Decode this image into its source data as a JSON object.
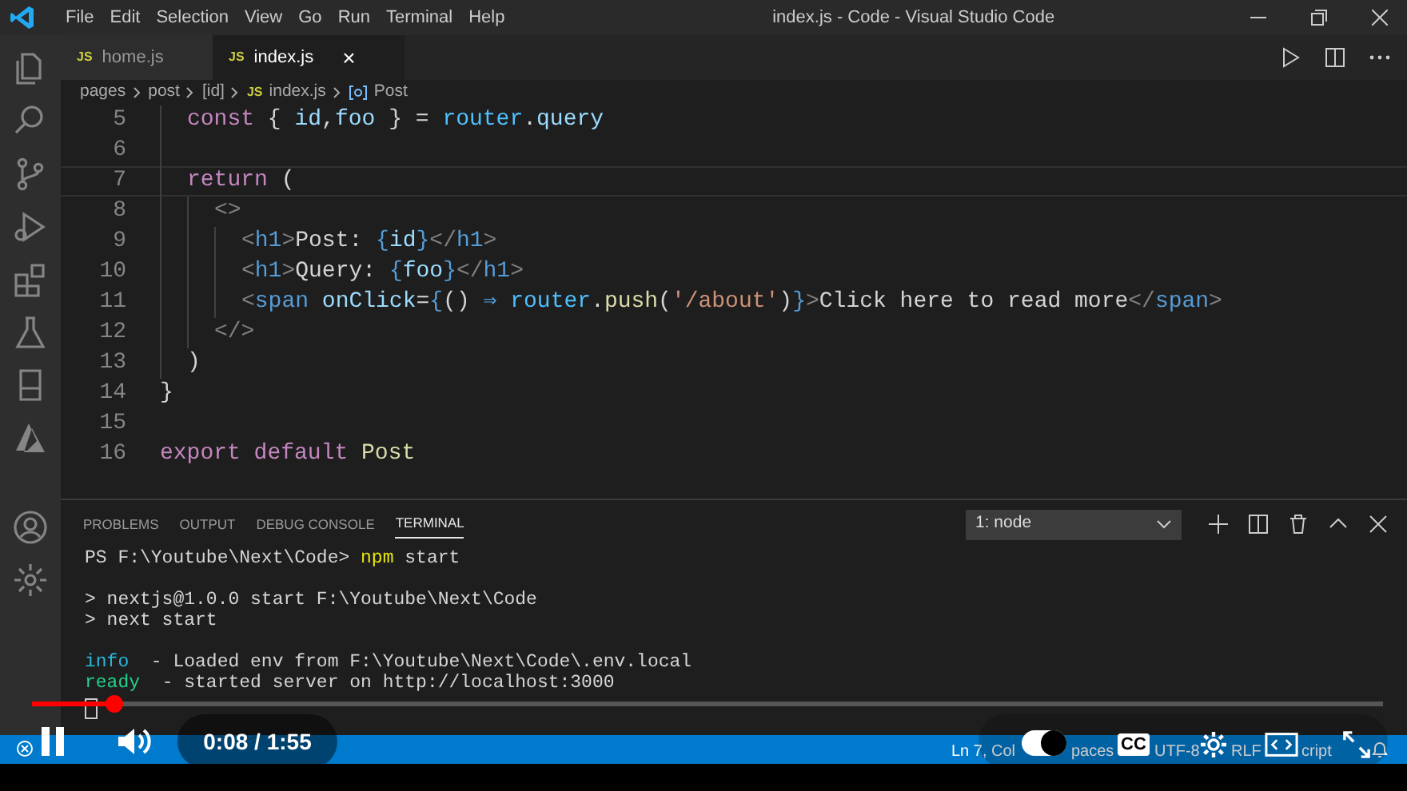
{
  "title_bar": {
    "menu": [
      "File",
      "Edit",
      "Selection",
      "View",
      "Go",
      "Run",
      "Terminal",
      "Help"
    ],
    "title": "index.js - Code - Visual Studio Code"
  },
  "tabs": [
    {
      "badge": "JS",
      "label": "home.js",
      "selected": false
    },
    {
      "badge": "JS",
      "label": "index.js",
      "selected": true,
      "close": "×"
    }
  ],
  "breadcrumbs": [
    {
      "kind": "folder",
      "label": "pages"
    },
    {
      "kind": "folder",
      "label": "post"
    },
    {
      "kind": "folder",
      "label": "[id]"
    },
    {
      "kind": "file",
      "badge": "JS",
      "label": "index.js"
    },
    {
      "kind": "symbol",
      "label": "Post"
    }
  ],
  "editor": {
    "lines": [
      {
        "children": [
          {
            "number": "5",
            "current": false,
            "tokens": [
              {
                "kind": "keyword",
                "text": "const "
              },
              {
                "kind": "text",
                "text": "{ "
              },
              {
                "kind": "var",
                "text": "id"
              },
              {
                "kind": "text",
                "text": ","
              },
              {
                "kind": "var",
                "text": "foo"
              },
              {
                "kind": "text",
                "text": " } = "
              },
              {
                "kind": "obj",
                "text": "router"
              },
              {
                "kind": "text",
                "text": "."
              },
              {
                "kind": "var",
                "text": "query"
              }
            ]
          },
          {
            "number": "6",
            "current": false
          },
          {
            "number": "7",
            "current": true,
            "tokens": [
              {
                "kind": "keyword",
                "text": "return "
              },
              {
                "kind": "text",
                "text": "("
              }
            ],
            "children": [
              {
                "number": "8",
                "current": false,
                "tokens": [
                  {
                    "kind": "punct",
                    "text": "<>"
                  }
                ],
                "children": [
                  {
                    "number": "9",
                    "current": false,
                    "tokens": [
                      {
                        "kind": "punct",
                        "text": "<"
                      },
                      {
                        "kind": "tag",
                        "text": "h1"
                      },
                      {
                        "kind": "punct",
                        "text": ">"
                      },
                      {
                        "kind": "text",
                        "text": "Post: "
                      },
                      {
                        "kind": "tag",
                        "text": "{"
                      },
                      {
                        "kind": "var",
                        "text": "id"
                      },
                      {
                        "kind": "tag",
                        "text": "}"
                      },
                      {
                        "kind": "punct",
                        "text": "</"
                      },
                      {
                        "kind": "tag",
                        "text": "h1"
                      },
                      {
                        "kind": "punct",
                        "text": ">"
                      }
                    ]
                  },
                  {
                    "number": "10",
                    "current": false,
                    "tokens": [
                      {
                        "kind": "punct",
                        "text": "<"
                      },
                      {
                        "kind": "tag",
                        "text": "h1"
                      },
                      {
                        "kind": "punct",
                        "text": ">"
                      },
                      {
                        "kind": "text",
                        "text": "Query: "
                      },
                      {
                        "kind": "tag",
                        "text": "{"
                      },
                      {
                        "kind": "var",
                        "text": "foo"
                      },
                      {
                        "kind": "tag",
                        "text": "}"
                      },
                      {
                        "kind": "punct",
                        "text": "</"
                      },
                      {
                        "kind": "tag",
                        "text": "h1"
                      },
                      {
                        "kind": "punct",
                        "text": ">"
                      }
                    ]
                  },
                  {
                    "number": "11",
                    "current": false,
                    "tokens": [
                      {
                        "kind": "punct",
                        "text": "<"
                      },
                      {
                        "kind": "tag",
                        "text": "span "
                      },
                      {
                        "kind": "var",
                        "text": "onClick"
                      },
                      {
                        "kind": "text",
                        "text": "="
                      },
                      {
                        "kind": "tag",
                        "text": "{"
                      },
                      {
                        "kind": "text",
                        "text": "() "
                      },
                      {
                        "kind": "tag",
                        "text": "⇒ "
                      },
                      {
                        "kind": "obj",
                        "text": "router"
                      },
                      {
                        "kind": "text",
                        "text": "."
                      },
                      {
                        "kind": "func",
                        "text": "push"
                      },
                      {
                        "kind": "text",
                        "text": "("
                      },
                      {
                        "kind": "string",
                        "text": "'/about'"
                      },
                      {
                        "kind": "text",
                        "text": ")"
                      },
                      {
                        "kind": "tag",
                        "text": "}"
                      },
                      {
                        "kind": "punct",
                        "text": ">"
                      },
                      {
                        "kind": "text",
                        "text": "Click here to read more"
                      },
                      {
                        "kind": "punct",
                        "text": "</"
                      },
                      {
                        "kind": "tag",
                        "text": "span"
                      },
                      {
                        "kind": "punct",
                        "text": ">"
                      }
                    ]
                  }
                ]
              },
              {
                "number": "12",
                "current": false,
                "tokens": [
                  {
                    "kind": "punct",
                    "text": "</>"
                  }
                ]
              }
            ]
          },
          {
            "number": "13",
            "current": false,
            "tokens": [
              {
                "kind": "text",
                "text": ")"
              }
            ]
          }
        ]
      },
      {
        "number": "14",
        "current": false,
        "tokens": [
          {
            "kind": "text",
            "text": "}"
          }
        ]
      },
      {
        "number": "15",
        "current": false
      },
      {
        "number": "16",
        "current": false,
        "tokens": [
          {
            "kind": "keyword",
            "text": "export default "
          },
          {
            "kind": "func",
            "text": "Post"
          }
        ]
      }
    ]
  },
  "panel": {
    "tabs": [
      {
        "label": "PROBLEMS",
        "selected": false
      },
      {
        "label": "OUTPUT",
        "selected": false
      },
      {
        "label": "DEBUG CONSOLE",
        "selected": false
      },
      {
        "label": "TERMINAL",
        "selected": true
      }
    ],
    "terminal_select": "1: node",
    "blocks": [
      [
        {
          "tokens": [
            {
              "kind": "text",
              "text": "PS F:\\Youtube\\Next\\Code> "
            },
            {
              "kind": "command",
              "text": "npm"
            },
            {
              "kind": "text",
              "text": " start"
            }
          ]
        }
      ],
      [
        {
          "tokens": [
            {
              "kind": "text",
              "text": "> nextjs@1.0.0 start F:\\Youtube\\Next\\Code"
            }
          ]
        },
        {
          "tokens": [
            {
              "kind": "text",
              "text": "> next start"
            }
          ]
        }
      ],
      [
        {
          "tokens": [
            {
              "kind": "info",
              "text": "info"
            },
            {
              "kind": "text",
              "text": "  - Loaded env from F:\\Youtube\\Next\\Code\\.env.local"
            }
          ]
        },
        {
          "tokens": [
            {
              "kind": "ready",
              "text": "ready"
            },
            {
              "kind": "text",
              "text": "  - started server on http://localhost:3000"
            }
          ]
        }
      ]
    ]
  },
  "status_bar": {
    "items": [
      "Ln 7, Col",
      "paces",
      "UTF-8",
      "RLF",
      "cript"
    ]
  },
  "player": {
    "playing": true,
    "progress": {
      "level": 0.06
    },
    "time": "0:08 / 1:55",
    "autoplay": true,
    "captions": "CC"
  }
}
